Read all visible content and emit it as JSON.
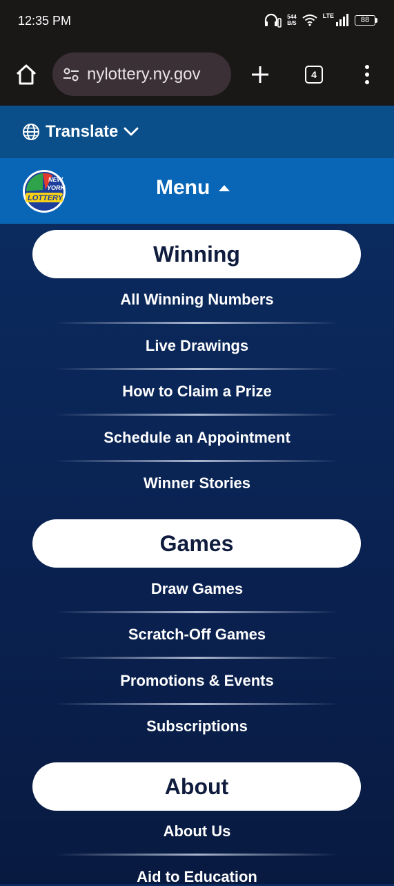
{
  "status": {
    "time": "12:35 PM",
    "speed_value": "544",
    "speed_unit": "B/S",
    "network": "LTE",
    "battery": "88"
  },
  "browser": {
    "url": "nylottery.ny.gov",
    "tab_count": "4"
  },
  "translate": {
    "label": "Translate"
  },
  "menu": {
    "label": "Menu",
    "logo_text": [
      "NEW",
      "YORK",
      "LOTTERY"
    ]
  },
  "sections": [
    {
      "title": "Winning",
      "links": [
        "All Winning Numbers",
        "Live Drawings",
        "How to Claim a Prize",
        "Schedule an Appointment",
        "Winner Stories"
      ]
    },
    {
      "title": "Games",
      "links": [
        "Draw Games",
        "Scratch-Off Games",
        "Promotions & Events",
        "Subscriptions"
      ]
    },
    {
      "title": "About",
      "links": [
        "About Us",
        "Aid to Education"
      ]
    }
  ],
  "colors": {
    "chrome": "#1a1717",
    "translate_bar": "#0b4f8a",
    "menu_bar": "#0966b6",
    "content_bg": "#0a2150"
  }
}
